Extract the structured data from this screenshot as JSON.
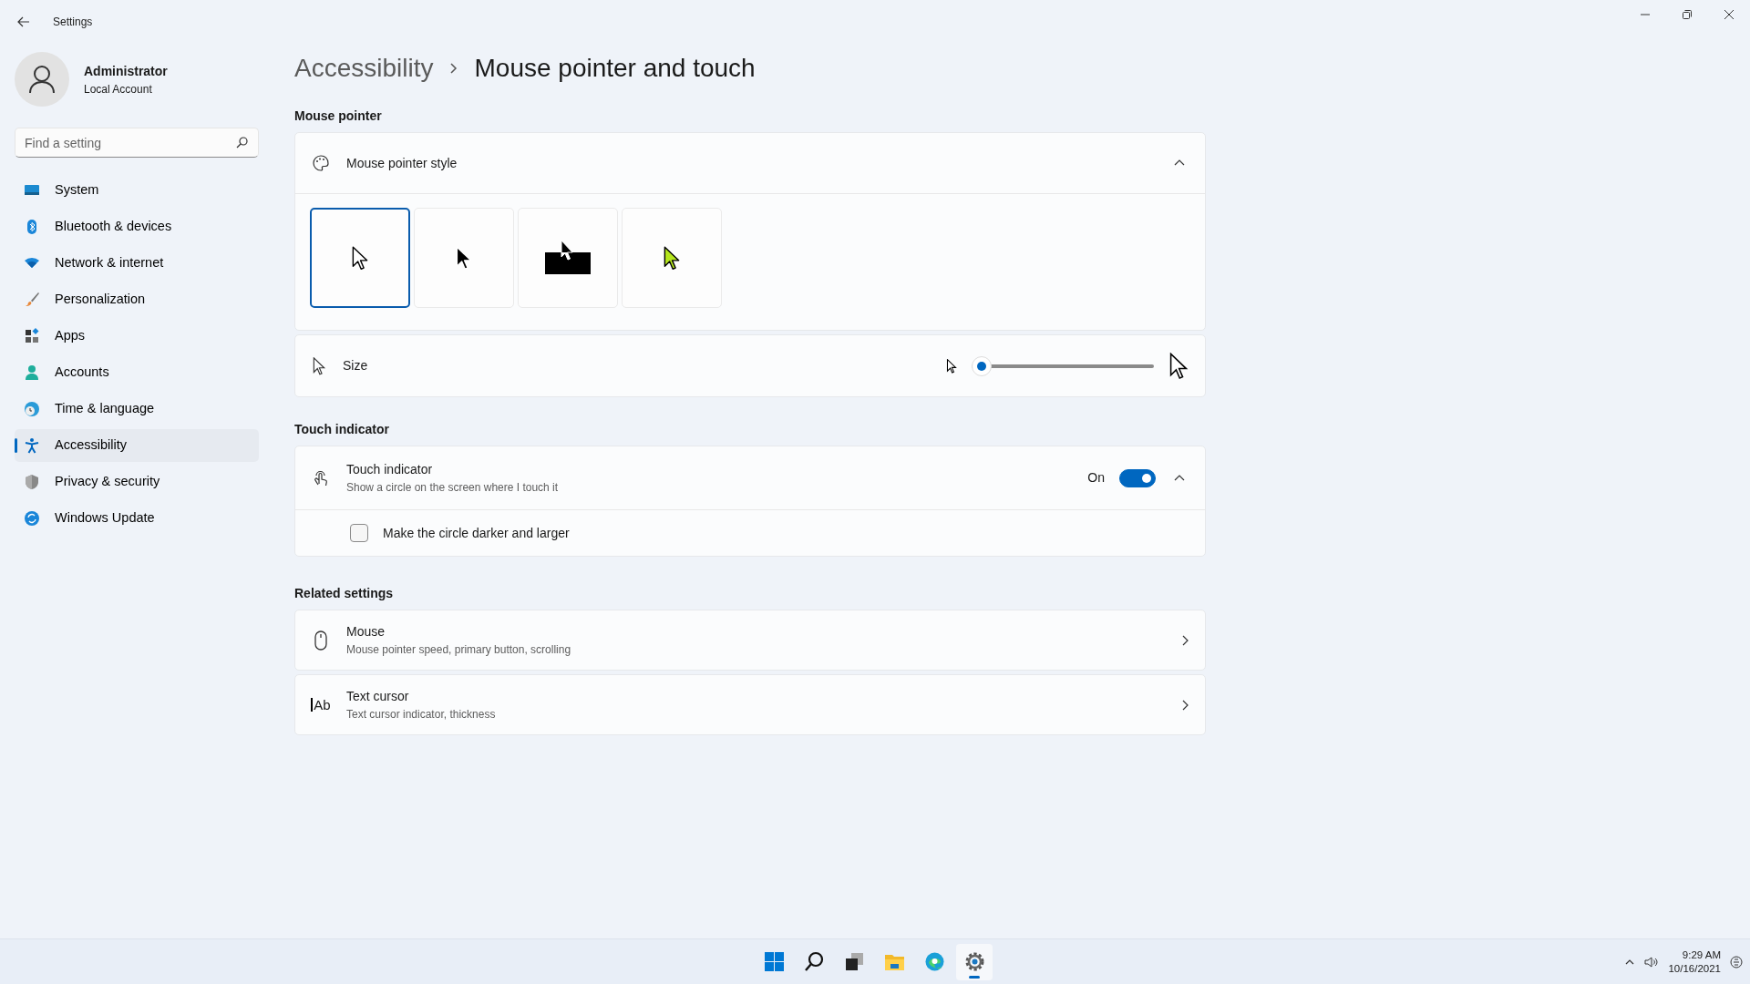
{
  "window": {
    "title": "Settings"
  },
  "profile": {
    "name": "Administrator",
    "account": "Local Account"
  },
  "search": {
    "placeholder": "Find a setting"
  },
  "sidebar": {
    "items": [
      {
        "kind": "system",
        "label": "System",
        "selected": false
      },
      {
        "kind": "bluetooth",
        "label": "Bluetooth & devices",
        "selected": false
      },
      {
        "kind": "network",
        "label": "Network & internet",
        "selected": false
      },
      {
        "kind": "personalization",
        "label": "Personalization",
        "selected": false
      },
      {
        "kind": "apps",
        "label": "Apps",
        "selected": false
      },
      {
        "kind": "accounts",
        "label": "Accounts",
        "selected": false
      },
      {
        "kind": "time",
        "label": "Time & language",
        "selected": false
      },
      {
        "kind": "accessibility",
        "label": "Accessibility",
        "selected": true
      },
      {
        "kind": "privacy",
        "label": "Privacy & security",
        "selected": false
      },
      {
        "kind": "update",
        "label": "Windows Update",
        "selected": false
      }
    ]
  },
  "breadcrumb": [
    "Accessibility",
    "Mouse pointer and touch"
  ],
  "mouse_pointer": {
    "heading": "Mouse pointer",
    "style_label": "Mouse pointer style",
    "expanded": true,
    "styles": [
      {
        "kind": "white",
        "selected": true
      },
      {
        "kind": "black",
        "selected": false
      },
      {
        "kind": "inverted",
        "selected": false
      },
      {
        "kind": "custom",
        "selected": false,
        "color": "#b5e61d"
      }
    ],
    "size": {
      "label": "Size",
      "level": 0
    }
  },
  "touch": {
    "heading": "Touch indicator",
    "title": "Touch indicator",
    "description": "Show a circle on the screen where I touch it",
    "state_label": "On",
    "on": true,
    "expanded": true,
    "option": {
      "label": "Make the circle darker and larger",
      "checked": false
    }
  },
  "related": {
    "heading": "Related settings",
    "items": [
      {
        "kind": "mouse",
        "title": "Mouse",
        "description": "Mouse pointer speed, primary button, scrolling"
      },
      {
        "kind": "text-cursor",
        "icon_text": "Ab",
        "title": "Text cursor",
        "description": "Text cursor indicator, thickness"
      }
    ]
  },
  "taskbar": {
    "apps": [
      {
        "kind": "start",
        "selected": false
      },
      {
        "kind": "search",
        "selected": false
      },
      {
        "kind": "task-view",
        "selected": false
      },
      {
        "kind": "explorer",
        "selected": false
      },
      {
        "kind": "edge",
        "selected": false
      },
      {
        "kind": "settings",
        "selected": true
      }
    ],
    "time": "9:29 AM",
    "date": "10/16/2021"
  }
}
